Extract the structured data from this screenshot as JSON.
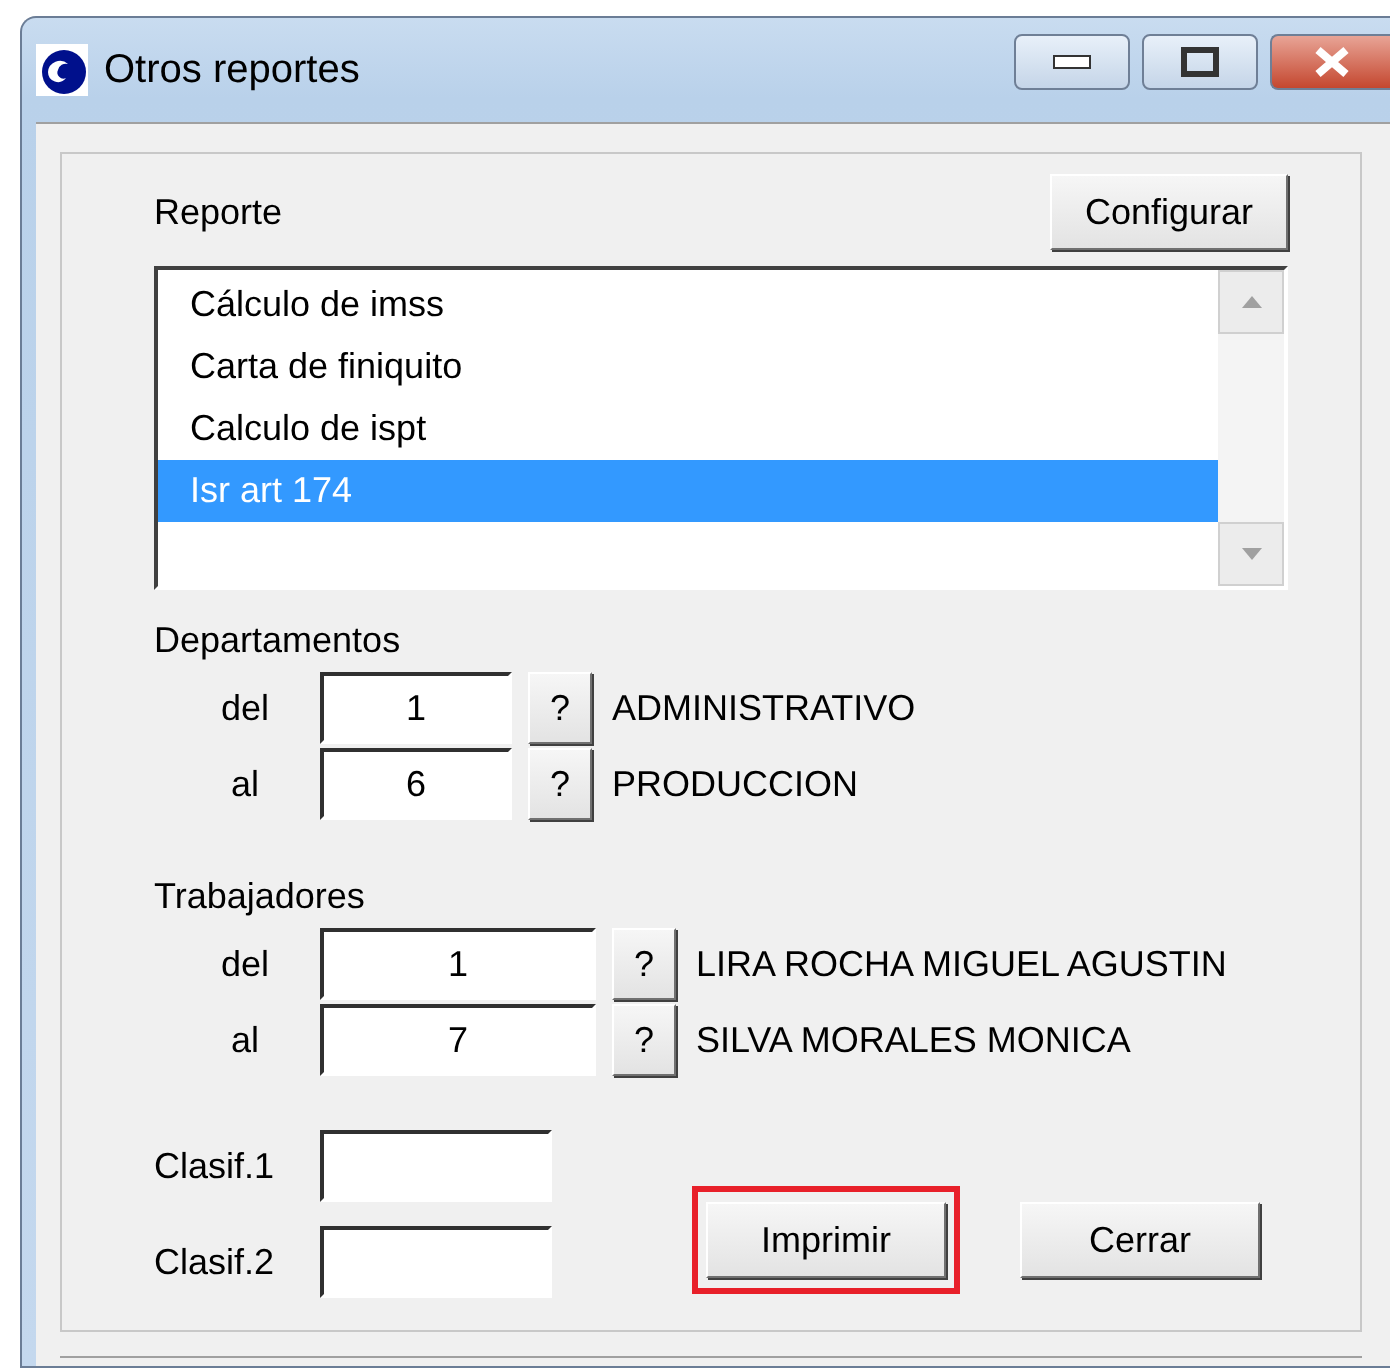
{
  "window": {
    "title": "Otros reportes"
  },
  "report": {
    "label": "Reporte",
    "configure_button": "Configurar",
    "items": [
      {
        "label": "Cálculo de imss",
        "selected": false
      },
      {
        "label": "Carta de finiquito",
        "selected": false
      },
      {
        "label": "Calculo de ispt",
        "selected": false
      },
      {
        "label": "Isr art 174",
        "selected": true
      }
    ]
  },
  "ranges": [
    {
      "label": "Departamentos",
      "rows": [
        {
          "label": "del",
          "value": "1",
          "lookup": "?",
          "name": "ADMINISTRATIVO"
        },
        {
          "label": "al",
          "value": "6",
          "lookup": "?",
          "name": "PRODUCCION"
        }
      ]
    },
    {
      "label": "Trabajadores",
      "rows": [
        {
          "label": "del",
          "value": "1",
          "lookup": "?",
          "name": "LIRA ROCHA MIGUEL AGUSTIN"
        },
        {
          "label": "al",
          "value": "7",
          "lookup": "?",
          "name": "SILVA MORALES MONICA"
        }
      ]
    }
  ],
  "classifications": [
    {
      "label": "Clasif.1"
    },
    {
      "label": "Clasif.2"
    }
  ],
  "buttons": [
    {
      "label": "Imprimir",
      "highlighted": true
    },
    {
      "label": "Cerrar",
      "highlighted": false
    }
  ]
}
